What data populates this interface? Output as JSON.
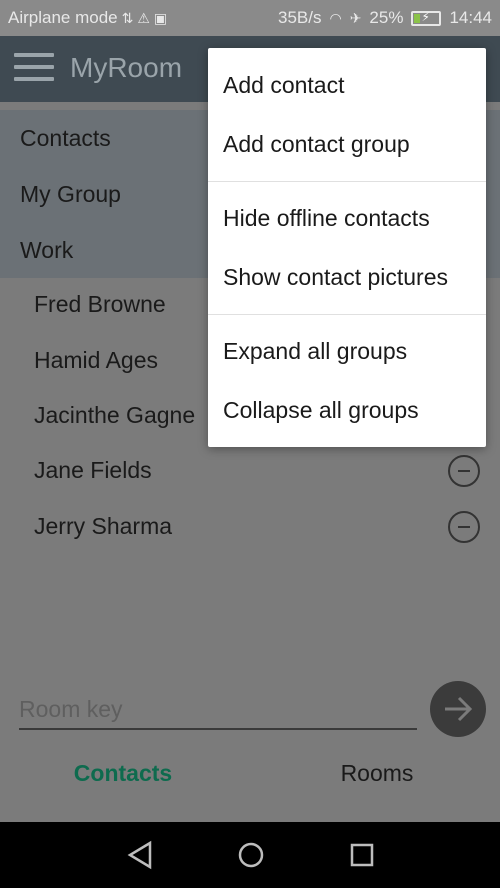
{
  "status_bar": {
    "carrier_text": "Airplane mode",
    "speed": "35B/s",
    "battery_percent": "25%",
    "time": "14:44",
    "battery_level": 0.25
  },
  "app_bar": {
    "title": "MyRoom"
  },
  "groups": [
    {
      "label": "Contacts"
    },
    {
      "label": "My Group"
    },
    {
      "label": "Work"
    }
  ],
  "contacts": [
    {
      "name": "Fred Browne"
    },
    {
      "name": "Hamid Ages"
    },
    {
      "name": "Jacinthe Gagne"
    },
    {
      "name": "Jane Fields"
    },
    {
      "name": "Jerry Sharma"
    }
  ],
  "room": {
    "placeholder": "Room key"
  },
  "tabs": [
    {
      "label": "Contacts",
      "active": true
    },
    {
      "label": "Rooms",
      "active": false
    }
  ],
  "menu": {
    "items": [
      {
        "label": "Add contact"
      },
      {
        "label": "Add contact group"
      },
      {
        "label": "Hide offline contacts"
      },
      {
        "label": "Show contact pictures"
      },
      {
        "label": "Expand all groups"
      },
      {
        "label": "Collapse all groups"
      }
    ]
  }
}
